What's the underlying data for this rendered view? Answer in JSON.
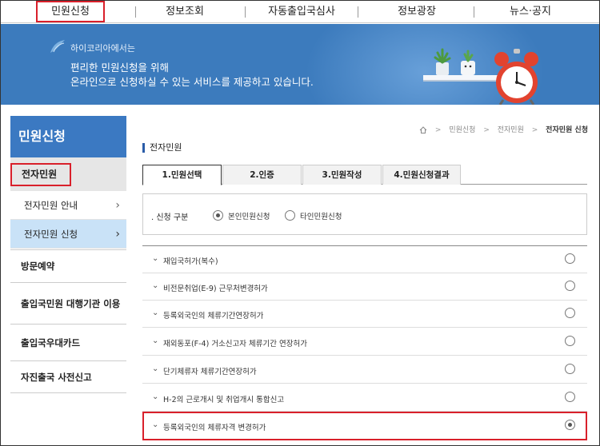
{
  "topnav": {
    "items": [
      "민원신청",
      "정보조회",
      "자동출입국심사",
      "정보광장",
      "뉴스·공지"
    ]
  },
  "banner": {
    "subtitle": "하이코리아에서는",
    "line1": "편리한 민원신청을 위해",
    "line2": "온라인으로 신청하실 수 있는 서비스를 제공하고 있습니다."
  },
  "sidebar": {
    "title": "민원신청",
    "current": "전자민원",
    "sub_items": [
      "전자민원 안내",
      "전자민원 신청"
    ],
    "items": [
      "방문예약",
      "출입국민원 대행기관 이용",
      "출입국우대카드",
      "자진출국 사전신고"
    ]
  },
  "breadcrumb": {
    "items": [
      "민원신청",
      "전자민원",
      "전자민원 신청"
    ]
  },
  "section_title": "전자민원",
  "tabs": [
    "1.민원선택",
    "2.인증",
    "3.민원작성",
    "4.민원신청결과"
  ],
  "apply_type": {
    "label": ". 신청 구분",
    "options": [
      "본인민원신청",
      "타인민원신청"
    ],
    "selected": "본인민원신청"
  },
  "applications": [
    {
      "label": "재입국허가(복수)",
      "selected": false
    },
    {
      "label": "비전문취업(E-9) 근무처변경허가",
      "selected": false
    },
    {
      "label": "등록외국인의 체류기간연장허가",
      "selected": false
    },
    {
      "label": "재외동포(F-4) 거소신고자 체류기간 연장허가",
      "selected": false
    },
    {
      "label": "단기체류자 체류기간연장허가",
      "selected": false
    },
    {
      "label": "H-2의 근로개시 및 취업개시 통합신고",
      "selected": false
    },
    {
      "label": "등록외국인의 체류자격 변경허가",
      "selected": true
    }
  ],
  "colors": {
    "highlight": "#d9202b",
    "banner": "#3c7bbd",
    "sidebar_title": "#3b79c2",
    "active_sub": "#c9e2f7"
  }
}
